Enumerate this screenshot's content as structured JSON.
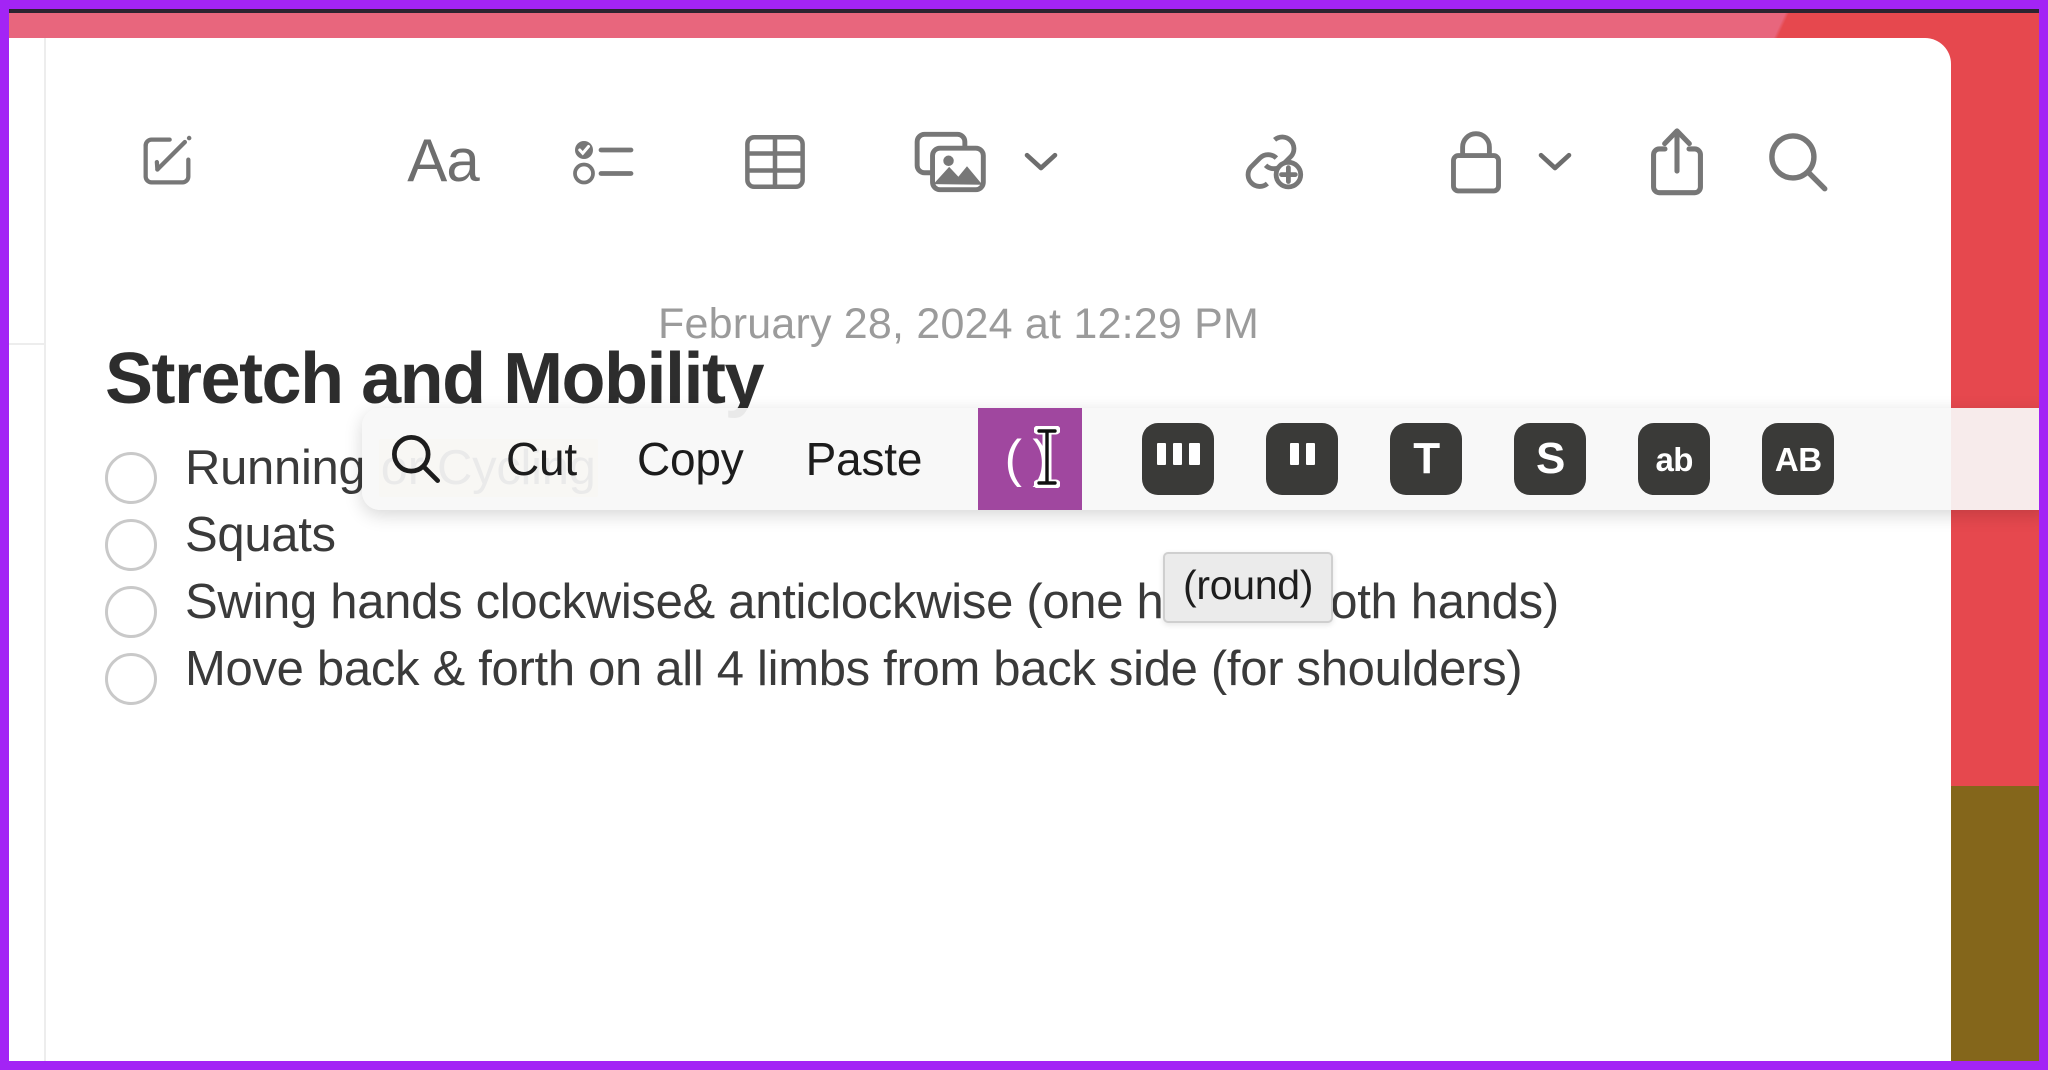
{
  "app": {
    "name": "Apple Notes",
    "accent_purple_frame": "#a324f5",
    "wallpaper_pink": "#e8667d",
    "wallpaper_red": "#e6484e",
    "wallpaper_olive": "#84661b"
  },
  "toolbar": {
    "items": [
      {
        "name": "compose-note-icon",
        "label": "Compose Note"
      },
      {
        "name": "format-icon",
        "label": "Aa"
      },
      {
        "name": "checklist-icon",
        "label": "Checklist"
      },
      {
        "name": "table-icon",
        "label": "Table"
      },
      {
        "name": "media-icon",
        "label": "Media"
      },
      {
        "name": "media-chevron-down-icon",
        "label": "Media options"
      },
      {
        "name": "add-link-icon",
        "label": "Add Link"
      },
      {
        "name": "lock-icon",
        "label": "Lock Note"
      },
      {
        "name": "lock-chevron-down-icon",
        "label": "Lock options"
      },
      {
        "name": "share-icon",
        "label": "Share"
      },
      {
        "name": "search-icon",
        "label": "Search"
      }
    ],
    "aa_label": "Aa"
  },
  "note": {
    "date": "February 28, 2024 at 12:29 PM",
    "title": "Stretch and Mobility",
    "checklist": [
      {
        "text_plain": "Running ",
        "text_highlight": "or Cycling",
        "checked": false,
        "highlight_color": "#fcecc4"
      },
      {
        "text_plain": "Squats",
        "text_highlight": "",
        "checked": false
      },
      {
        "text_plain": "Swing hands clockwise& anticlockwise (one hand & both hands)",
        "text_highlight": "",
        "checked": false
      },
      {
        "text_plain": "Move back & forth on all 4 limbs from back side (for shoulders)",
        "text_highlight": "",
        "checked": false
      }
    ]
  },
  "popup": {
    "search_icon_name": "search-icon",
    "actions": [
      {
        "name": "cut-button",
        "label": "Cut"
      },
      {
        "name": "copy-button",
        "label": "Copy"
      },
      {
        "name": "paste-button",
        "label": "Paste"
      }
    ],
    "selected": {
      "name": "round-brackets-button",
      "label": "( )",
      "highlight_color": "#a0479f"
    },
    "keys": [
      {
        "name": "triple-quote-key",
        "label": "\"\"\"",
        "kind": "quote3"
      },
      {
        "name": "double-quote-key",
        "label": "\"\"",
        "kind": "quote2"
      },
      {
        "name": "uppercase-t-key",
        "label": "T",
        "kind": "text"
      },
      {
        "name": "s-key",
        "label": "S",
        "kind": "text"
      },
      {
        "name": "lowercase-ab-key",
        "label": "ab",
        "kind": "small"
      },
      {
        "name": "uppercase-ab-key",
        "label": "AB",
        "kind": "small"
      }
    ]
  },
  "tooltip": {
    "text": "(round)"
  }
}
